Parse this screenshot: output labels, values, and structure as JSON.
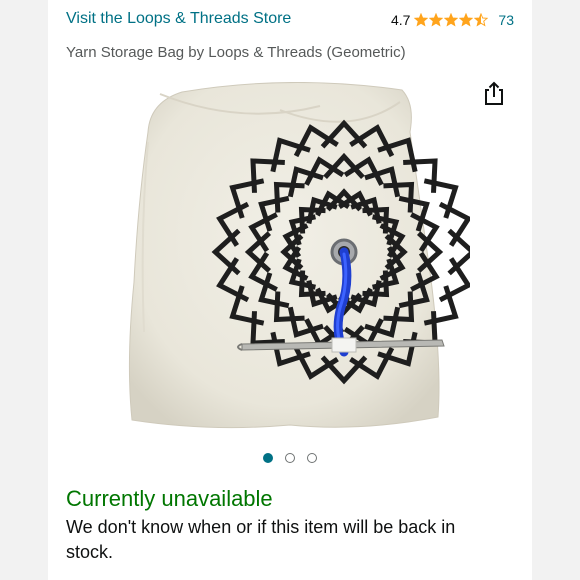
{
  "store": {
    "link_text": "Visit the Loops & Threads Store"
  },
  "rating": {
    "value": "4.7",
    "stars_out_of_5": 4.5,
    "count": "73"
  },
  "product": {
    "title": "Yarn Storage Bag by Loops & Threads (Geometric)"
  },
  "carousel": {
    "total_images": 3,
    "active_index": 0
  },
  "availability": {
    "status": "Currently unavailable",
    "message": "We don't know when or if this item will be back in stock."
  },
  "colors": {
    "link": "#007185",
    "star": "#ffa41c",
    "unavailable": "#007600",
    "text": "#0f1111",
    "muted": "#565959"
  },
  "icons": {
    "share": "share-icon",
    "star": "star-icon"
  }
}
